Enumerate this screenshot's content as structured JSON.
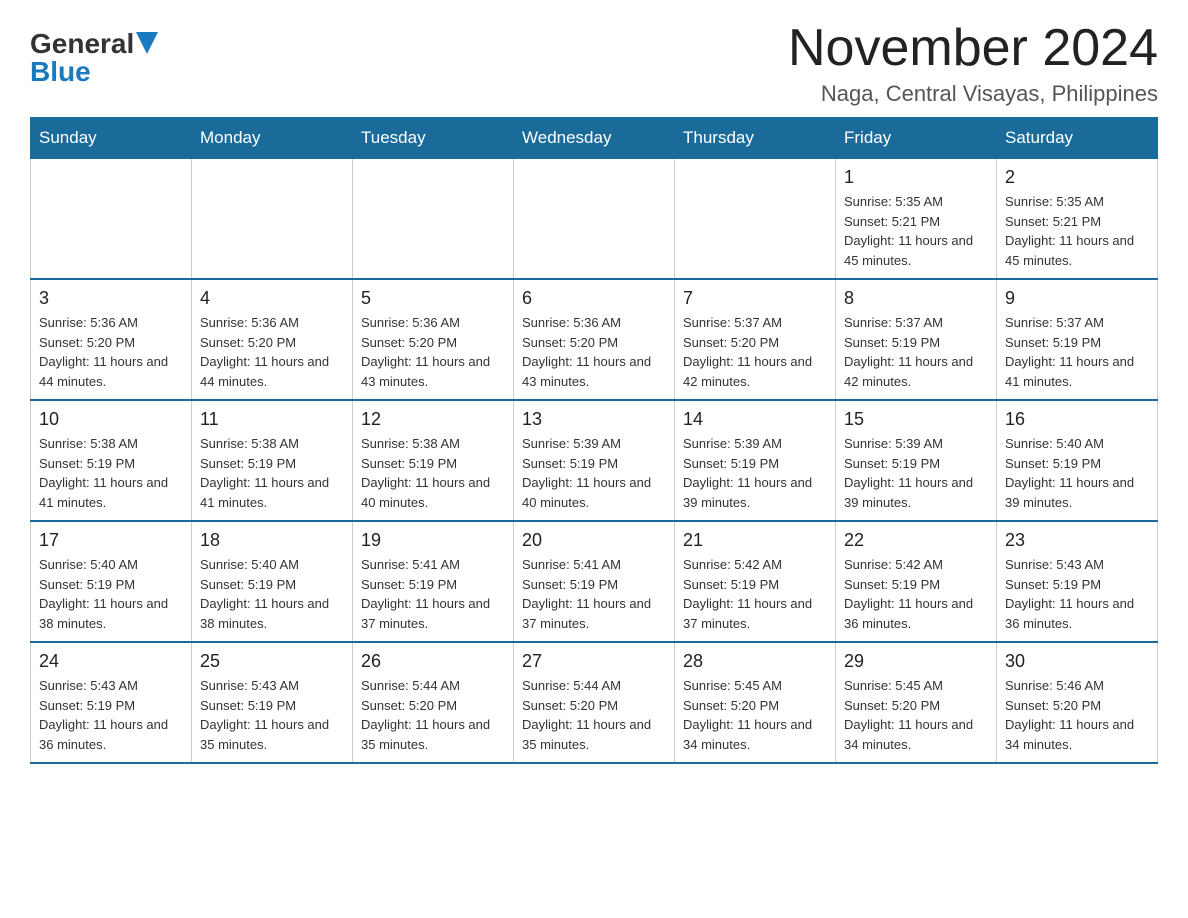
{
  "logo": {
    "general": "General",
    "blue": "Blue"
  },
  "title": "November 2024",
  "location": "Naga, Central Visayas, Philippines",
  "days_of_week": [
    "Sunday",
    "Monday",
    "Tuesday",
    "Wednesday",
    "Thursday",
    "Friday",
    "Saturday"
  ],
  "weeks": [
    [
      {
        "day": "",
        "info": ""
      },
      {
        "day": "",
        "info": ""
      },
      {
        "day": "",
        "info": ""
      },
      {
        "day": "",
        "info": ""
      },
      {
        "day": "",
        "info": ""
      },
      {
        "day": "1",
        "info": "Sunrise: 5:35 AM\nSunset: 5:21 PM\nDaylight: 11 hours and 45 minutes."
      },
      {
        "day": "2",
        "info": "Sunrise: 5:35 AM\nSunset: 5:21 PM\nDaylight: 11 hours and 45 minutes."
      }
    ],
    [
      {
        "day": "3",
        "info": "Sunrise: 5:36 AM\nSunset: 5:20 PM\nDaylight: 11 hours and 44 minutes."
      },
      {
        "day": "4",
        "info": "Sunrise: 5:36 AM\nSunset: 5:20 PM\nDaylight: 11 hours and 44 minutes."
      },
      {
        "day": "5",
        "info": "Sunrise: 5:36 AM\nSunset: 5:20 PM\nDaylight: 11 hours and 43 minutes."
      },
      {
        "day": "6",
        "info": "Sunrise: 5:36 AM\nSunset: 5:20 PM\nDaylight: 11 hours and 43 minutes."
      },
      {
        "day": "7",
        "info": "Sunrise: 5:37 AM\nSunset: 5:20 PM\nDaylight: 11 hours and 42 minutes."
      },
      {
        "day": "8",
        "info": "Sunrise: 5:37 AM\nSunset: 5:19 PM\nDaylight: 11 hours and 42 minutes."
      },
      {
        "day": "9",
        "info": "Sunrise: 5:37 AM\nSunset: 5:19 PM\nDaylight: 11 hours and 41 minutes."
      }
    ],
    [
      {
        "day": "10",
        "info": "Sunrise: 5:38 AM\nSunset: 5:19 PM\nDaylight: 11 hours and 41 minutes."
      },
      {
        "day": "11",
        "info": "Sunrise: 5:38 AM\nSunset: 5:19 PM\nDaylight: 11 hours and 41 minutes."
      },
      {
        "day": "12",
        "info": "Sunrise: 5:38 AM\nSunset: 5:19 PM\nDaylight: 11 hours and 40 minutes."
      },
      {
        "day": "13",
        "info": "Sunrise: 5:39 AM\nSunset: 5:19 PM\nDaylight: 11 hours and 40 minutes."
      },
      {
        "day": "14",
        "info": "Sunrise: 5:39 AM\nSunset: 5:19 PM\nDaylight: 11 hours and 39 minutes."
      },
      {
        "day": "15",
        "info": "Sunrise: 5:39 AM\nSunset: 5:19 PM\nDaylight: 11 hours and 39 minutes."
      },
      {
        "day": "16",
        "info": "Sunrise: 5:40 AM\nSunset: 5:19 PM\nDaylight: 11 hours and 39 minutes."
      }
    ],
    [
      {
        "day": "17",
        "info": "Sunrise: 5:40 AM\nSunset: 5:19 PM\nDaylight: 11 hours and 38 minutes."
      },
      {
        "day": "18",
        "info": "Sunrise: 5:40 AM\nSunset: 5:19 PM\nDaylight: 11 hours and 38 minutes."
      },
      {
        "day": "19",
        "info": "Sunrise: 5:41 AM\nSunset: 5:19 PM\nDaylight: 11 hours and 37 minutes."
      },
      {
        "day": "20",
        "info": "Sunrise: 5:41 AM\nSunset: 5:19 PM\nDaylight: 11 hours and 37 minutes."
      },
      {
        "day": "21",
        "info": "Sunrise: 5:42 AM\nSunset: 5:19 PM\nDaylight: 11 hours and 37 minutes."
      },
      {
        "day": "22",
        "info": "Sunrise: 5:42 AM\nSunset: 5:19 PM\nDaylight: 11 hours and 36 minutes."
      },
      {
        "day": "23",
        "info": "Sunrise: 5:43 AM\nSunset: 5:19 PM\nDaylight: 11 hours and 36 minutes."
      }
    ],
    [
      {
        "day": "24",
        "info": "Sunrise: 5:43 AM\nSunset: 5:19 PM\nDaylight: 11 hours and 36 minutes."
      },
      {
        "day": "25",
        "info": "Sunrise: 5:43 AM\nSunset: 5:19 PM\nDaylight: 11 hours and 35 minutes."
      },
      {
        "day": "26",
        "info": "Sunrise: 5:44 AM\nSunset: 5:20 PM\nDaylight: 11 hours and 35 minutes."
      },
      {
        "day": "27",
        "info": "Sunrise: 5:44 AM\nSunset: 5:20 PM\nDaylight: 11 hours and 35 minutes."
      },
      {
        "day": "28",
        "info": "Sunrise: 5:45 AM\nSunset: 5:20 PM\nDaylight: 11 hours and 34 minutes."
      },
      {
        "day": "29",
        "info": "Sunrise: 5:45 AM\nSunset: 5:20 PM\nDaylight: 11 hours and 34 minutes."
      },
      {
        "day": "30",
        "info": "Sunrise: 5:46 AM\nSunset: 5:20 PM\nDaylight: 11 hours and 34 minutes."
      }
    ]
  ]
}
